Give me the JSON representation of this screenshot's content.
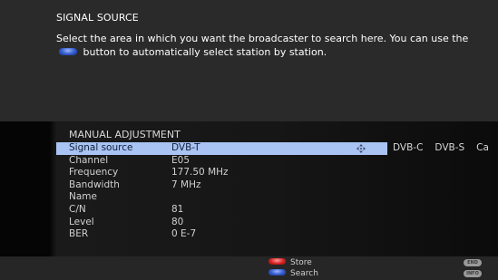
{
  "info": {
    "title": "SIGNAL SOURCE",
    "desc_before": "Select the area in which you want the broadcaster to search here. You can use the",
    "desc_after": "button to automatically select station by station."
  },
  "panel": {
    "heading": "MANUAL ADJUSTMENT",
    "rows": [
      {
        "label": "Signal source",
        "value": "DVB-T"
      },
      {
        "label": "Channel",
        "value": "E05"
      },
      {
        "label": "Frequency",
        "value": "177.50 MHz"
      },
      {
        "label": "Bandwidth",
        "value": "7 MHz"
      },
      {
        "label": "Name",
        "value": ""
      },
      {
        "label": "C/N",
        "value": "81"
      },
      {
        "label": "Level",
        "value": "80"
      },
      {
        "label": "BER",
        "value": "0 E-7"
      }
    ],
    "source_options": [
      "DVB-C",
      "DVB-S",
      "Ca"
    ]
  },
  "footer": {
    "store_label": "Store",
    "search_label": "Search",
    "end_key": "END",
    "info_key": "INFO"
  },
  "colors": {
    "selection": "#a9c3f3",
    "red_button": "#d42020",
    "blue_button": "#2f58c9"
  },
  "icons": {
    "inline_button": "blue-button-icon",
    "selector": "four-way-arrows-icon"
  }
}
